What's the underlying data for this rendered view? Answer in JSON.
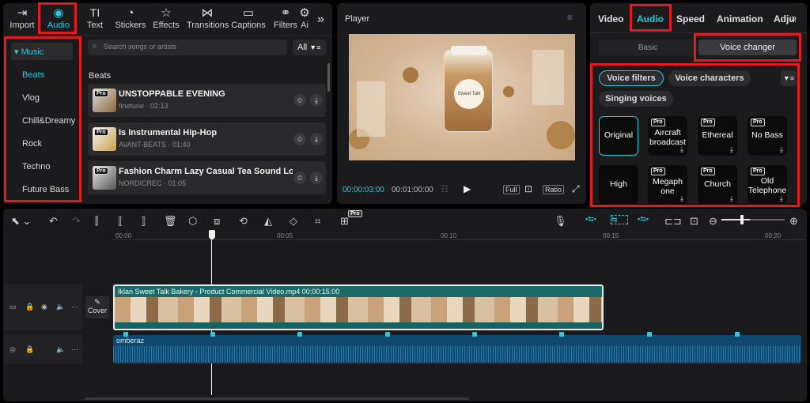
{
  "toolbar": {
    "items": [
      {
        "label": "Import",
        "icon": "import-icon"
      },
      {
        "label": "Audio",
        "icon": "audio-icon"
      },
      {
        "label": "Text",
        "icon": "text-icon"
      },
      {
        "label": "Stickers",
        "icon": "sticker-icon"
      },
      {
        "label": "Effects",
        "icon": "effects-icon"
      },
      {
        "label": "Transitions",
        "icon": "transitions-icon"
      },
      {
        "label": "Captions",
        "icon": "captions-icon"
      },
      {
        "label": "Filters",
        "icon": "filters-icon"
      },
      {
        "label": "Ai",
        "icon": "adjust-icon"
      }
    ],
    "more": "»",
    "text_glyph": "TI"
  },
  "sidebar": {
    "section": "Music",
    "categories": [
      "Beats",
      "Vlog",
      "Chill&Dreamy",
      "Rock",
      "Techno",
      "Future Bass"
    ]
  },
  "search": {
    "placeholder": "Search songs or artists",
    "filter_label": "All"
  },
  "music_list": {
    "heading": "Beats",
    "tracks": [
      {
        "title": "UNSTOPPABLE EVENING",
        "meta": "finetune · 02:13",
        "badge": "Pro"
      },
      {
        "title": "Is Instrumental Hip-Hop",
        "meta": "AVANT-BEATS · 01:40",
        "badge": "Pro"
      },
      {
        "title": "Fashion Charm Lazy Casual Tea Sound LoFi...",
        "meta": "NORDICREC · 01:05",
        "badge": "Pro"
      }
    ]
  },
  "player": {
    "title": "Player",
    "current_time": "00:00:03:00",
    "total_time": "00:01:00:00",
    "full_label": "Full",
    "ratio_label": "Ratio",
    "jar_label": "Sweet Talk"
  },
  "inspector": {
    "tabs": [
      "Video",
      "Audio",
      "Speed",
      "Animation",
      "Adjust"
    ],
    "subtabs": [
      "Basic",
      "Voice changer"
    ],
    "chips": [
      "Voice filters",
      "Voice characters",
      "Singing voices"
    ],
    "voices": [
      {
        "label": "Original",
        "pro": false
      },
      {
        "label": "Aircraft broadcast",
        "pro": true
      },
      {
        "label": "Ethereal",
        "pro": true
      },
      {
        "label": "No Bass",
        "pro": true
      },
      {
        "label": "High",
        "pro": false
      },
      {
        "label": "Megaphone",
        "pro": true
      },
      {
        "label": "Church",
        "pro": true
      },
      {
        "label": "Old Telephone",
        "pro": true
      }
    ],
    "pro_badge": "Pro"
  },
  "timeline": {
    "ruler": [
      "00:00",
      "00:05",
      "00:10",
      "00:15",
      "00:20"
    ],
    "cover_label": "Cover",
    "video_clip_label": "Iklan Sweet Talk Bakery - Product Commercial Video.mp4  00:00:15:00",
    "audio_clip_label": "omberaz",
    "pro_tag": "Pro"
  },
  "colors": {
    "accent": "#2ec7d6",
    "highlight_box": "#e01b22",
    "video_clip": "#1c6b6b",
    "audio_clip": "#0f4a6e"
  }
}
